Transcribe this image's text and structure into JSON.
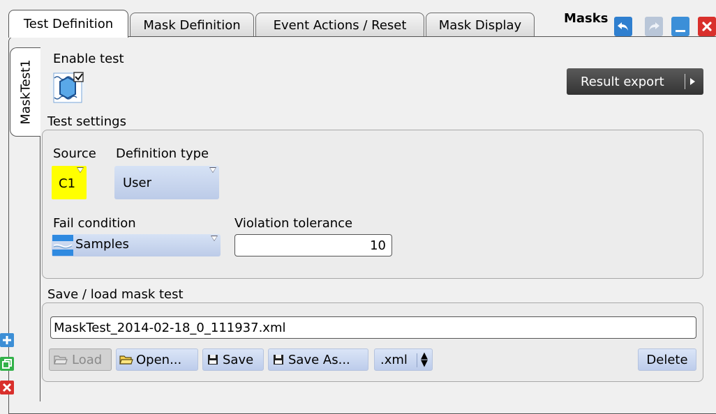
{
  "tabs": [
    {
      "label": "Test Definition",
      "active": true
    },
    {
      "label": "Mask Definition",
      "active": false
    },
    {
      "label": "Event Actions / Reset",
      "active": false
    },
    {
      "label": "Mask Display",
      "active": false
    }
  ],
  "window": {
    "title": "Masks",
    "undo_icon": "undo-icon",
    "redo_icon": "redo-icon",
    "minimize_icon": "minimize-icon",
    "close_icon": "close-icon"
  },
  "side_tab": {
    "label": "MaskTest1"
  },
  "enable_test": {
    "label": "Enable test",
    "checked": true,
    "icon": "mask-test-icon"
  },
  "result_export": {
    "label": "Result export"
  },
  "test_settings": {
    "label": "Test settings",
    "source_label": "Source",
    "source_value": "C1",
    "definition_type_label": "Definition type",
    "definition_type_value": "User",
    "fail_condition_label": "Fail condition",
    "fail_condition_value": "Samples",
    "violation_tolerance_label": "Violation tolerance",
    "violation_tolerance_value": "10"
  },
  "save_load": {
    "label": "Save / load mask test",
    "filename": "MaskTest_2014-02-18_0_111937.xml",
    "load_label": "Load",
    "open_label": "Open...",
    "save_label": "Save",
    "save_as_label": "Save As...",
    "extension_value": ".xml",
    "delete_label": "Delete"
  },
  "side_actions": {
    "add_icon": "add-icon",
    "copy_icon": "copy-icon",
    "delete_icon": "delete-icon"
  },
  "colors": {
    "source_yellow": "#ffff00",
    "button_blue": "#c9d6f0",
    "accent_blue": "#3c8fd8",
    "close_red": "#d9302c",
    "add_blue": "#3d8fd6",
    "copy_green": "#33b24a"
  }
}
